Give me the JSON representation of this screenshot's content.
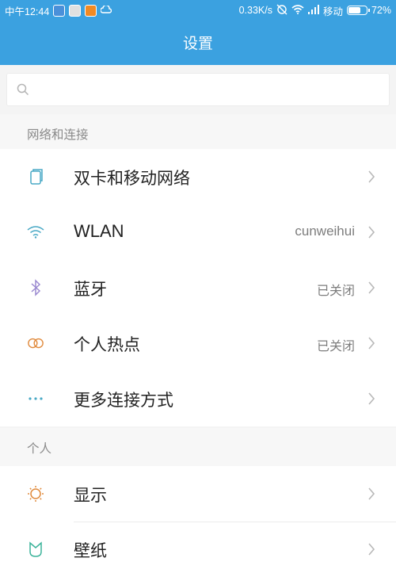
{
  "status_bar": {
    "time": "中午12:44",
    "net_speed": "0.33K/s",
    "carrier": "移动",
    "battery": "72%",
    "battery_level": 0.72
  },
  "header": {
    "title": "设置"
  },
  "search": {
    "placeholder": ""
  },
  "sections": {
    "network": {
      "title": "网络和连接",
      "items": [
        {
          "label": "双卡和移动网络",
          "value": "",
          "icon": "sim-card-icon"
        },
        {
          "label": "WLAN",
          "value": "cunweihui",
          "icon": "wifi-icon"
        },
        {
          "label": "蓝牙",
          "value": "已关闭",
          "icon": "bluetooth-icon"
        },
        {
          "label": "个人热点",
          "value": "已关闭",
          "icon": "hotspot-icon"
        },
        {
          "label": "更多连接方式",
          "value": "",
          "icon": "more-dots-icon"
        }
      ]
    },
    "personal": {
      "title": "个人",
      "items": [
        {
          "label": "显示",
          "value": "",
          "icon": "brightness-icon"
        },
        {
          "label": "壁纸",
          "value": "",
          "icon": "wallpaper-icon"
        }
      ]
    }
  },
  "colors": {
    "header": "#3ba1e0",
    "accent": "#3ba1e0"
  }
}
